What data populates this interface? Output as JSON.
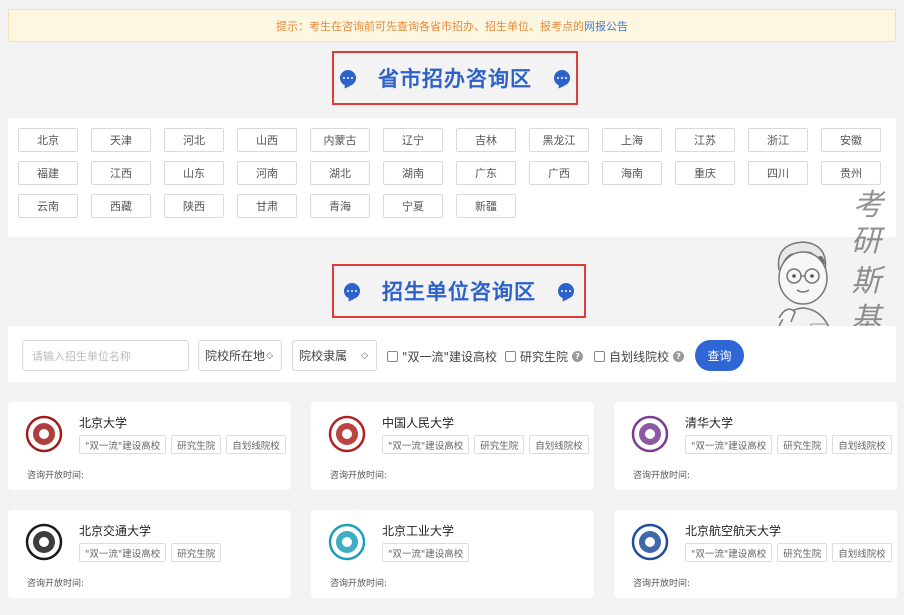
{
  "notice": {
    "text": "提示：考生在咨询前可先查询各省市招办、招生单位、报考点的",
    "link": "网报公告"
  },
  "sections": {
    "provincial": "省市招办咨询区",
    "institution": "招生单位咨询区"
  },
  "provinces": [
    "北京",
    "天津",
    "河北",
    "山西",
    "内蒙古",
    "辽宁",
    "吉林",
    "黑龙江",
    "上海",
    "江苏",
    "浙江",
    "安徽",
    "福建",
    "江西",
    "山东",
    "河南",
    "湖北",
    "湖南",
    "广东",
    "广西",
    "海南",
    "重庆",
    "四川",
    "贵州",
    "云南",
    "西藏",
    "陕西",
    "甘肃",
    "青海",
    "宁夏",
    "新疆"
  ],
  "search": {
    "placeholder": "请输入招生单位名称",
    "location_select": "院校所在地",
    "affiliation_select": "院校隶属",
    "filters": [
      "\"双一流\"建设高校",
      "研究生院",
      "自划线院校"
    ],
    "query_button": "查询"
  },
  "universities": [
    {
      "name": "北京大学",
      "tags": [
        "\"双一流\"建设高校",
        "研究生院",
        "自划线院校"
      ],
      "open_time_label": "咨询开放时间:",
      "logo_color": "#a01c1c"
    },
    {
      "name": "中国人民大学",
      "tags": [
        "\"双一流\"建设高校",
        "研究生院",
        "自划线院校"
      ],
      "open_time_label": "咨询开放时间:",
      "logo_color": "#b02222"
    },
    {
      "name": "清华大学",
      "tags": [
        "\"双一流\"建设高校",
        "研究生院",
        "自划线院校"
      ],
      "open_time_label": "咨询开放时间:",
      "logo_color": "#7b3c92"
    },
    {
      "name": "北京交通大学",
      "tags": [
        "\"双一流\"建设高校",
        "研究生院"
      ],
      "open_time_label": "咨询开放时间:",
      "logo_color": "#1a1a1a"
    },
    {
      "name": "北京工业大学",
      "tags": [
        "\"双一流\"建设高校"
      ],
      "open_time_label": "咨询开放时间:",
      "logo_color": "#1d9fb8"
    },
    {
      "name": "北京航空航天大学",
      "tags": [
        "\"双一流\"建设高校",
        "研究生院",
        "自划线院校"
      ],
      "open_time_label": "咨询开放时间:",
      "logo_color": "#1f4d9a"
    }
  ],
  "watermark": [
    "考",
    "研",
    "斯",
    "基"
  ]
}
